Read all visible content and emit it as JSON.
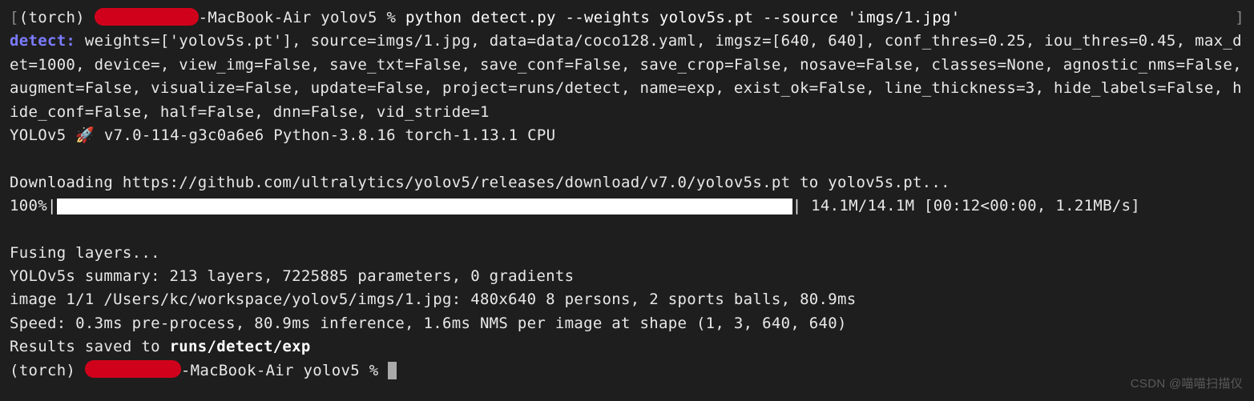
{
  "prompt": {
    "bracket_open": "[",
    "env": "(torch) ",
    "host_suffix": "-MacBook-Air yolov5 % ",
    "command": "python detect.py --weights yolov5s.pt --source 'imgs/1.jpg'",
    "bracket_close": "]"
  },
  "detect": {
    "label": "detect: ",
    "params": "weights=['yolov5s.pt'], source=imgs/1.jpg, data=data/coco128.yaml, imgsz=[640, 640], conf_thres=0.25, iou_thres=0.45, max_det=1000, device=, view_img=False, save_txt=False, save_conf=False, save_crop=False, nosave=False, classes=None, agnostic_nms=False, augment=False, visualize=False, update=False, project=runs/detect, name=exp, exist_ok=False, line_thickness=3, hide_labels=False, hide_conf=False, half=False, dnn=False, vid_stride=1"
  },
  "version": {
    "prefix": "YOLOv5 ",
    "rocket": "🚀",
    "rest": " v7.0-114-g3c0a6e6 Python-3.8.16 torch-1.13.1 CPU"
  },
  "download": {
    "line": "Downloading https://github.com/ultralytics/yolov5/releases/download/v7.0/yolov5s.pt to yolov5s.pt..."
  },
  "progress": {
    "pct": "100%|",
    "stats": "| 14.1M/14.1M [00:12<00:00, 1.21MB/s]"
  },
  "fusing": "Fusing layers... ",
  "summary": "YOLOv5s summary: 213 layers, 7225885 parameters, 0 gradients",
  "image": "image 1/1 /Users/kc/workspace/yolov5/imgs/1.jpg: 480x640 8 persons, 2 sports balls, 80.9ms",
  "speed": "Speed: 0.3ms pre-process, 80.9ms inference, 1.6ms NMS per image at shape (1, 3, 640, 640)",
  "results": {
    "prefix": "Results saved to ",
    "path": "runs/detect/exp"
  },
  "prompt2": {
    "env": "(torch) ",
    "host_suffix": "-MacBook-Air yolov5 % "
  },
  "watermark": "CSDN @喵喵扫描仪"
}
